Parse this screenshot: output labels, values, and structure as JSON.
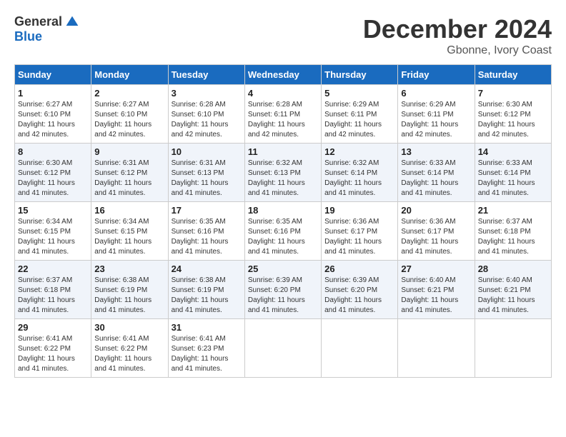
{
  "logo": {
    "general": "General",
    "blue": "Blue"
  },
  "title": {
    "month": "December 2024",
    "location": "Gbonne, Ivory Coast"
  },
  "headers": [
    "Sunday",
    "Monday",
    "Tuesday",
    "Wednesday",
    "Thursday",
    "Friday",
    "Saturday"
  ],
  "weeks": [
    [
      {
        "day": "1",
        "sunrise": "6:27 AM",
        "sunset": "6:10 PM",
        "daylight": "11 hours and 42 minutes."
      },
      {
        "day": "2",
        "sunrise": "6:27 AM",
        "sunset": "6:10 PM",
        "daylight": "11 hours and 42 minutes."
      },
      {
        "day": "3",
        "sunrise": "6:28 AM",
        "sunset": "6:10 PM",
        "daylight": "11 hours and 42 minutes."
      },
      {
        "day": "4",
        "sunrise": "6:28 AM",
        "sunset": "6:11 PM",
        "daylight": "11 hours and 42 minutes."
      },
      {
        "day": "5",
        "sunrise": "6:29 AM",
        "sunset": "6:11 PM",
        "daylight": "11 hours and 42 minutes."
      },
      {
        "day": "6",
        "sunrise": "6:29 AM",
        "sunset": "6:11 PM",
        "daylight": "11 hours and 42 minutes."
      },
      {
        "day": "7",
        "sunrise": "6:30 AM",
        "sunset": "6:12 PM",
        "daylight": "11 hours and 42 minutes."
      }
    ],
    [
      {
        "day": "8",
        "sunrise": "6:30 AM",
        "sunset": "6:12 PM",
        "daylight": "11 hours and 41 minutes."
      },
      {
        "day": "9",
        "sunrise": "6:31 AM",
        "sunset": "6:12 PM",
        "daylight": "11 hours and 41 minutes."
      },
      {
        "day": "10",
        "sunrise": "6:31 AM",
        "sunset": "6:13 PM",
        "daylight": "11 hours and 41 minutes."
      },
      {
        "day": "11",
        "sunrise": "6:32 AM",
        "sunset": "6:13 PM",
        "daylight": "11 hours and 41 minutes."
      },
      {
        "day": "12",
        "sunrise": "6:32 AM",
        "sunset": "6:14 PM",
        "daylight": "11 hours and 41 minutes."
      },
      {
        "day": "13",
        "sunrise": "6:33 AM",
        "sunset": "6:14 PM",
        "daylight": "11 hours and 41 minutes."
      },
      {
        "day": "14",
        "sunrise": "6:33 AM",
        "sunset": "6:14 PM",
        "daylight": "11 hours and 41 minutes."
      }
    ],
    [
      {
        "day": "15",
        "sunrise": "6:34 AM",
        "sunset": "6:15 PM",
        "daylight": "11 hours and 41 minutes."
      },
      {
        "day": "16",
        "sunrise": "6:34 AM",
        "sunset": "6:15 PM",
        "daylight": "11 hours and 41 minutes."
      },
      {
        "day": "17",
        "sunrise": "6:35 AM",
        "sunset": "6:16 PM",
        "daylight": "11 hours and 41 minutes."
      },
      {
        "day": "18",
        "sunrise": "6:35 AM",
        "sunset": "6:16 PM",
        "daylight": "11 hours and 41 minutes."
      },
      {
        "day": "19",
        "sunrise": "6:36 AM",
        "sunset": "6:17 PM",
        "daylight": "11 hours and 41 minutes."
      },
      {
        "day": "20",
        "sunrise": "6:36 AM",
        "sunset": "6:17 PM",
        "daylight": "11 hours and 41 minutes."
      },
      {
        "day": "21",
        "sunrise": "6:37 AM",
        "sunset": "6:18 PM",
        "daylight": "11 hours and 41 minutes."
      }
    ],
    [
      {
        "day": "22",
        "sunrise": "6:37 AM",
        "sunset": "6:18 PM",
        "daylight": "11 hours and 41 minutes."
      },
      {
        "day": "23",
        "sunrise": "6:38 AM",
        "sunset": "6:19 PM",
        "daylight": "11 hours and 41 minutes."
      },
      {
        "day": "24",
        "sunrise": "6:38 AM",
        "sunset": "6:19 PM",
        "daylight": "11 hours and 41 minutes."
      },
      {
        "day": "25",
        "sunrise": "6:39 AM",
        "sunset": "6:20 PM",
        "daylight": "11 hours and 41 minutes."
      },
      {
        "day": "26",
        "sunrise": "6:39 AM",
        "sunset": "6:20 PM",
        "daylight": "11 hours and 41 minutes."
      },
      {
        "day": "27",
        "sunrise": "6:40 AM",
        "sunset": "6:21 PM",
        "daylight": "11 hours and 41 minutes."
      },
      {
        "day": "28",
        "sunrise": "6:40 AM",
        "sunset": "6:21 PM",
        "daylight": "11 hours and 41 minutes."
      }
    ],
    [
      {
        "day": "29",
        "sunrise": "6:41 AM",
        "sunset": "6:22 PM",
        "daylight": "11 hours and 41 minutes."
      },
      {
        "day": "30",
        "sunrise": "6:41 AM",
        "sunset": "6:22 PM",
        "daylight": "11 hours and 41 minutes."
      },
      {
        "day": "31",
        "sunrise": "6:41 AM",
        "sunset": "6:23 PM",
        "daylight": "11 hours and 41 minutes."
      },
      null,
      null,
      null,
      null
    ]
  ]
}
